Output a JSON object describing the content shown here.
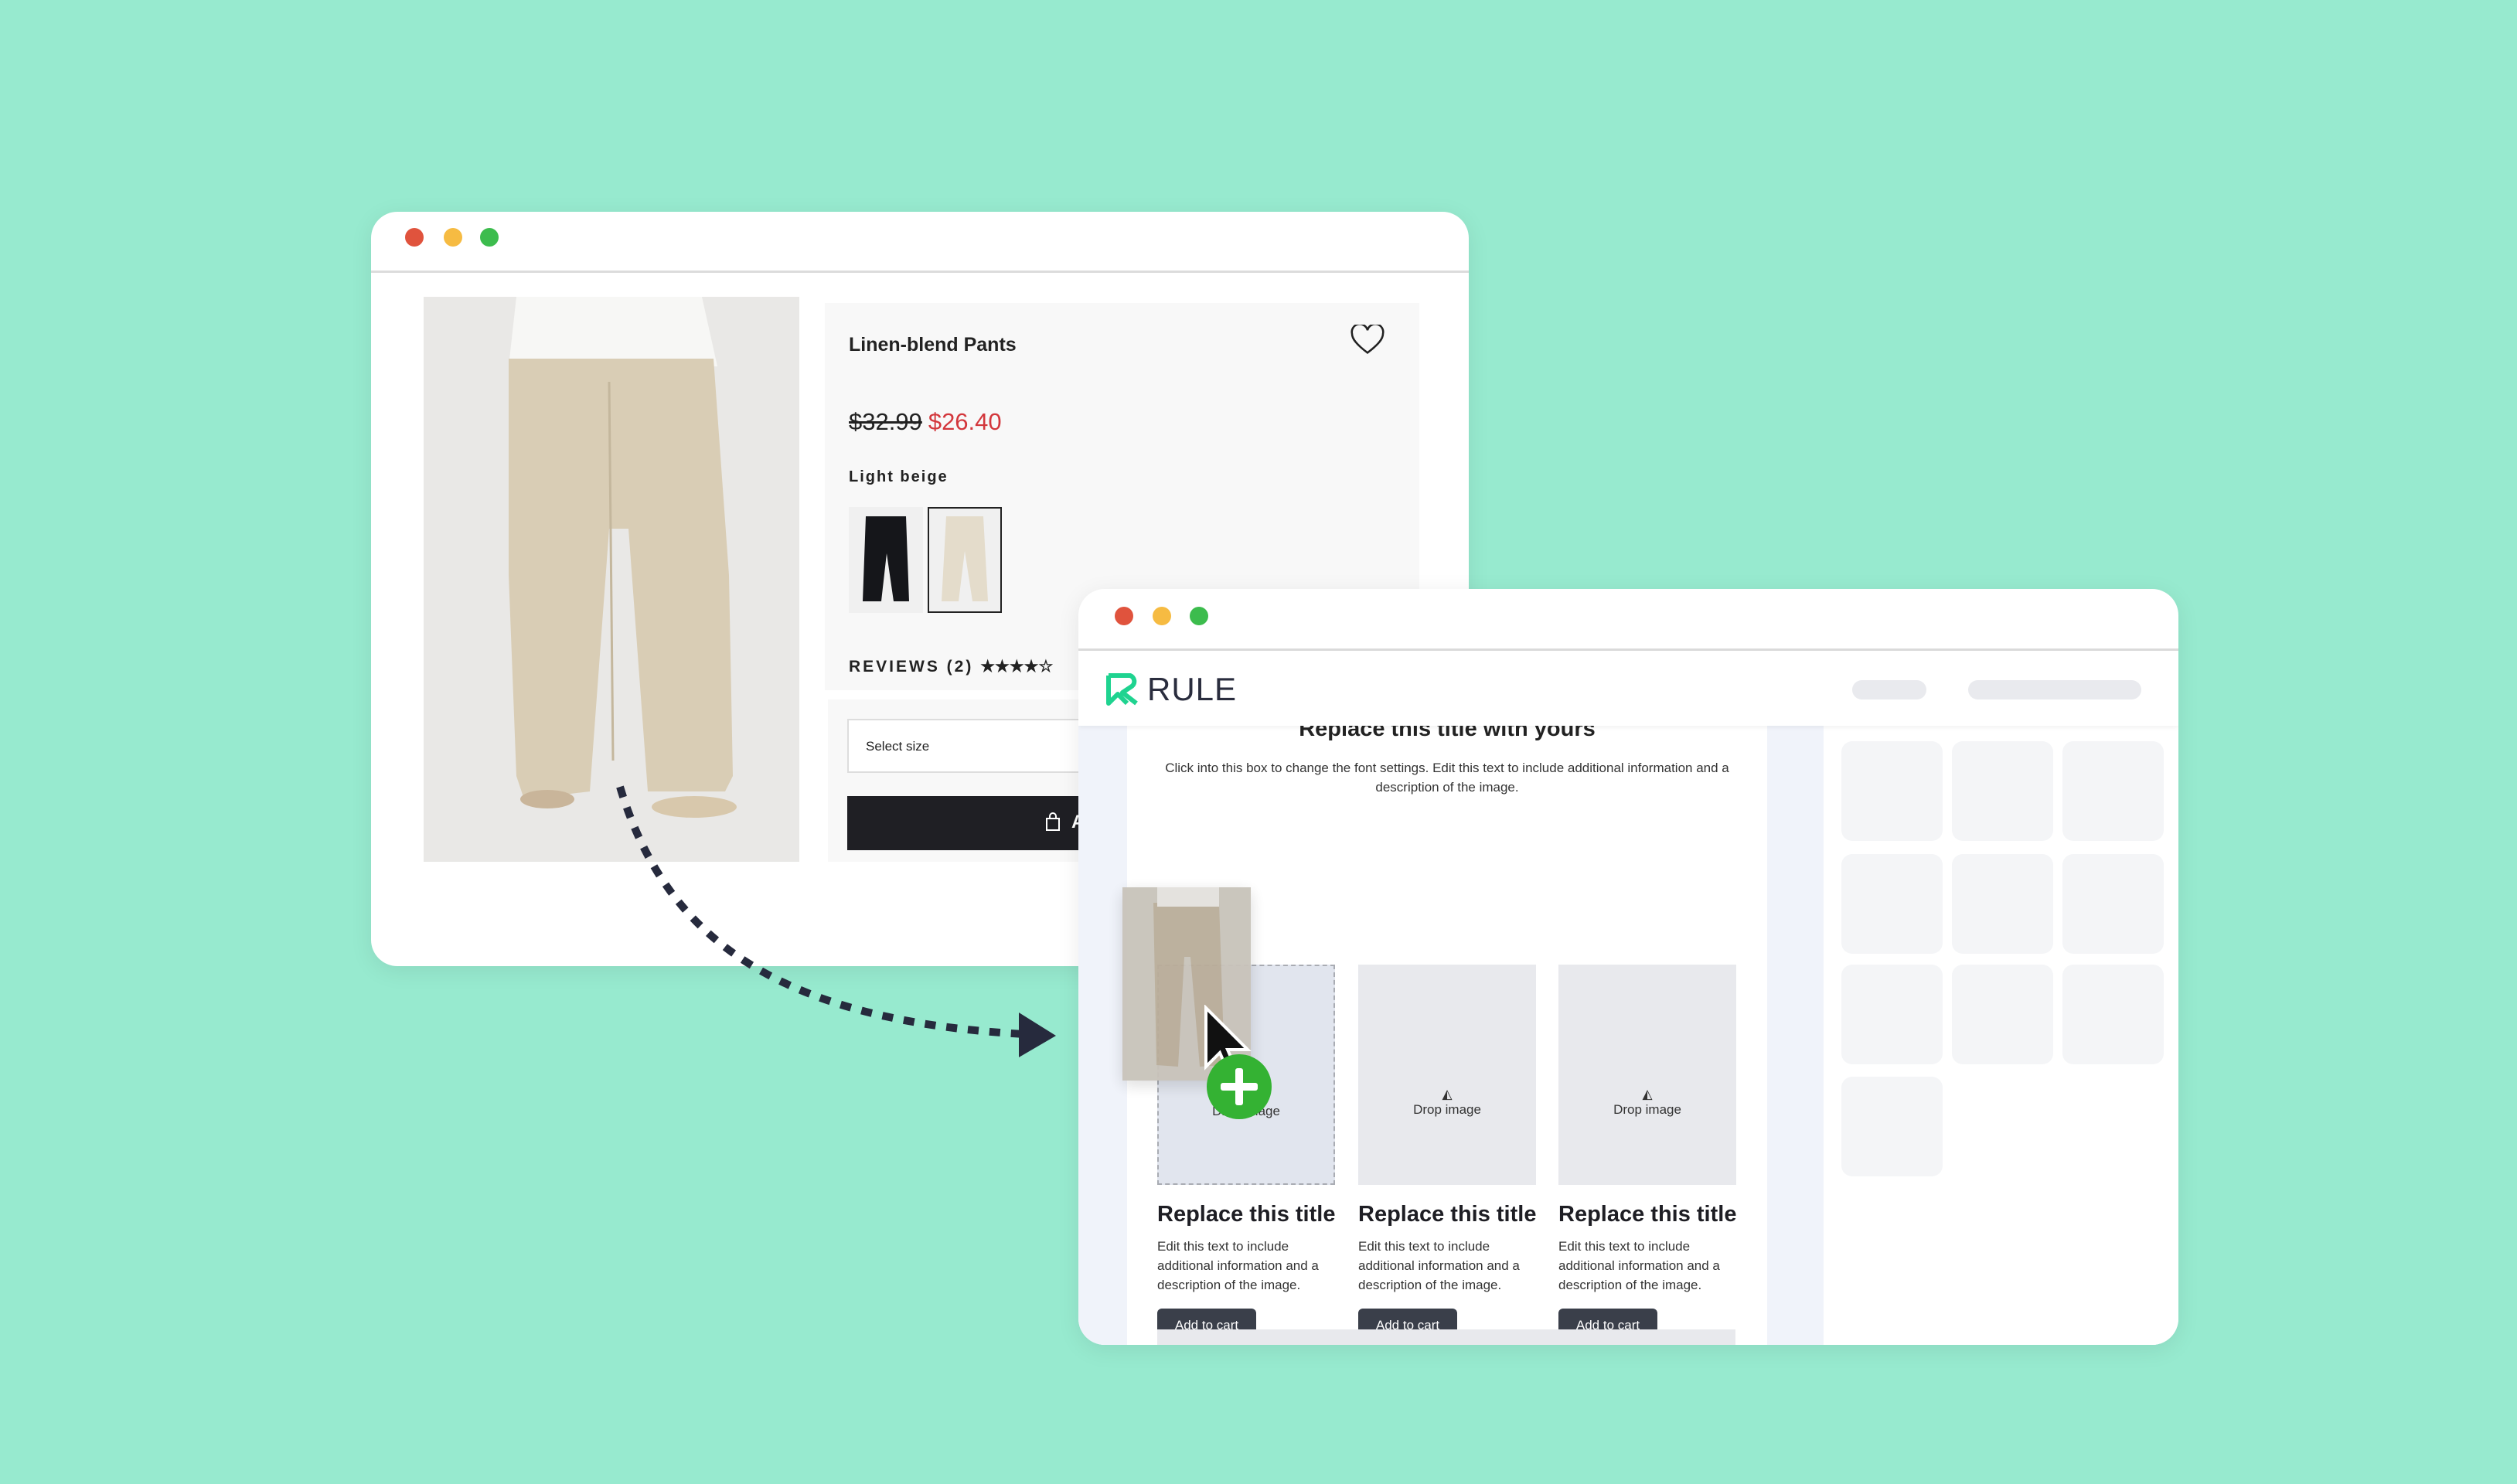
{
  "colors": {
    "background": "#97eacf",
    "sale_price": "#d3373c",
    "brand_green": "#1fd390",
    "dot_red": "#e0533d",
    "dot_yellow": "#f6bb42",
    "dot_green": "#3cbc4d",
    "plus_green": "#34b233"
  },
  "product_window": {
    "product_title": "Linen-blend Pants",
    "old_price": "$32.99",
    "sale_price": "$26.40",
    "color_label": "Light beige",
    "swatches": [
      "black",
      "light-beige"
    ],
    "selected_swatch": "light-beige",
    "reviews_label": "REVIEWS (2)",
    "rating": 4.5,
    "rating_max": 5,
    "size_select_placeholder": "Select size",
    "add_button_label": "A"
  },
  "editor_window": {
    "brand": "RULE",
    "section_title": "Replace this title with yours",
    "section_text": "Click into this box to change the font settings. Edit this text to include additional information and a description of the image.",
    "cards": [
      {
        "drop": "Drop image",
        "title": "Replace this title",
        "text": "Edit this text to include additional information and a description of the image.",
        "button": "Add to cart"
      },
      {
        "drop": "Drop image",
        "title": "Replace this title",
        "text": "Edit this text to include additional information and a description of the image.",
        "button": "Add to cart"
      },
      {
        "drop": "Drop image",
        "title": "Replace this title",
        "text": "Edit this text to include additional information and a description of the image.",
        "button": "Add to cart"
      }
    ]
  }
}
